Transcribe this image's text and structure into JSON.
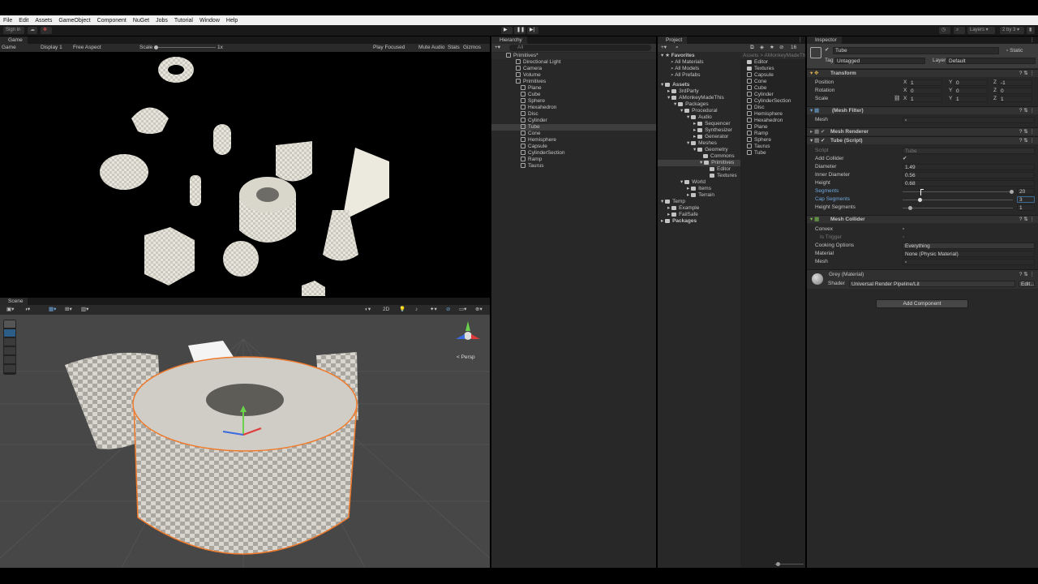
{
  "menu": [
    "File",
    "Edit",
    "Assets",
    "GameObject",
    "Component",
    "NuGet",
    "Jobs",
    "Tutorial",
    "Window",
    "Help"
  ],
  "toolbar": {
    "sign_in": "Sign in",
    "layers": "Layers",
    "layout": "2 by 3"
  },
  "game": {
    "tab": "Game",
    "mode": "Game",
    "display": "Display 1",
    "aspect": "Free Aspect",
    "scale_label": "Scale",
    "scale_value": "1x",
    "play_focused": "Play Focused",
    "mute": "Mute Audio",
    "stats": "Stats",
    "gizmos": "Gizmos"
  },
  "scene": {
    "tab": "Scene",
    "persp": "< Persp",
    "grid_value": "2D"
  },
  "hierarchy": {
    "tab": "Hierarchy",
    "search_placeholder": "All",
    "items": [
      "Primitives*",
      "Directional Light",
      "Camera",
      "Volume",
      "Primitives",
      "Plane",
      "Cube",
      "Sphere",
      "Hexahedron",
      "Disc",
      "Cylinder",
      "Tube",
      "Cone",
      "Hemisphere",
      "Capsule",
      "CylinderSection",
      "Ramp",
      "Taurus"
    ]
  },
  "project": {
    "tab": "Project",
    "badge": "16",
    "favorites": "Favorites",
    "fav_items": [
      "All Materials",
      "All Models",
      "All Prefabs"
    ],
    "assets": "Assets",
    "tree": [
      "3rdParty",
      "AMonkeyMadeThis",
      "Packages",
      "Procedural",
      "Audio",
      "Sequencer",
      "Synthesizer",
      "Generator",
      "Meshes",
      "Geometry",
      "Commons",
      "Primitives",
      "Editor",
      "Textures",
      "World",
      "Items",
      "Terrain",
      "Temp",
      "Example",
      "FailSafe",
      "Packages"
    ],
    "breadcrumb": "Assets > AMonkeyMadeTh",
    "files": [
      "Editor",
      "Textures",
      "Capsule",
      "Cone",
      "Cube",
      "Cylinder",
      "CylinderSection",
      "Disc",
      "Hemisphere",
      "Hexahedron",
      "Plane",
      "Ramp",
      "Sphere",
      "Taurus",
      "Tube"
    ]
  },
  "inspector": {
    "tab": "Inspector",
    "name": "Tube",
    "static": "Static",
    "tag_label": "Tag",
    "tag_value": "Untagged",
    "layer_label": "Layer",
    "layer_value": "Default",
    "transform": {
      "title": "Transform",
      "position": "Position",
      "rotation": "Rotation",
      "scale": "Scale",
      "pos": [
        "1",
        "0",
        "-1"
      ],
      "rot": [
        "0",
        "0",
        "0"
      ],
      "scl": [
        "1",
        "1",
        "1"
      ],
      "axes": [
        "X",
        "Y",
        "Z"
      ]
    },
    "mesh_filter": {
      "title": "(Mesh Filter)",
      "mesh": "Mesh"
    },
    "mesh_renderer": {
      "title": "Mesh Renderer"
    },
    "tube_script": {
      "title": "Tube (Script)",
      "script_label": "Script",
      "script_value": "Tube",
      "add_collider": "Add Collider",
      "diameter": "Diameter",
      "diameter_v": "1.49",
      "inner": "Inner Diameter",
      "inner_v": "0.56",
      "height": "Height",
      "height_v": "0.68",
      "segments": "Segments",
      "segments_v": "20",
      "cap": "Cap Segments",
      "cap_v": "3",
      "hseg": "Height Segments",
      "hseg_v": "1"
    },
    "mesh_collider": {
      "title": "Mesh Collider",
      "convex": "Convex",
      "is_trigger": "Is Trigger",
      "cooking": "Cooking Options",
      "cooking_v": "Everything",
      "material": "Material",
      "material_v": "None (Physic Material)",
      "mesh": "Mesh"
    },
    "material": {
      "title": "Grey (Material)",
      "shader_label": "Shader",
      "shader_v": "Universal Render Pipeline/Lit",
      "edit": "Edit..."
    },
    "add_component": "Add Component"
  },
  "colors": {
    "accent": "#2c5d87",
    "selection_outline": "#f07a2c",
    "menu_bg": "#f0f0f0"
  }
}
